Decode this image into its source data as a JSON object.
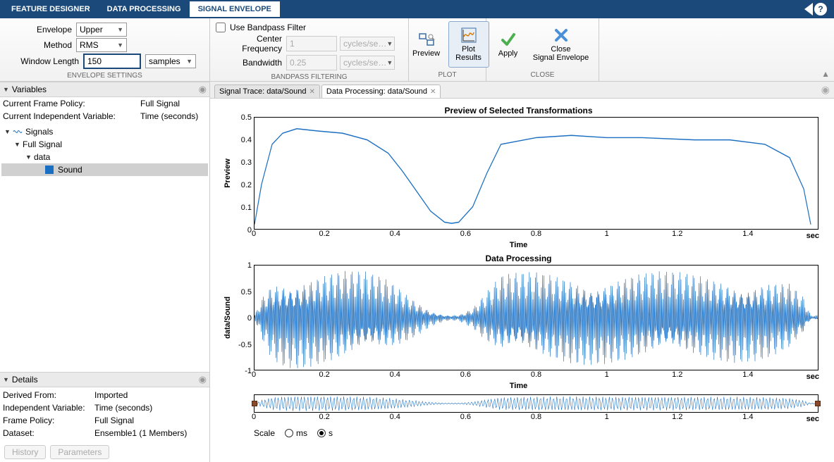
{
  "tabs": {
    "feature": "FEATURE DESIGNER",
    "dp": "DATA PROCESSING",
    "se": "SIGNAL ENVELOPE"
  },
  "settings": {
    "envelope_label": "Envelope",
    "envelope_value": "Upper",
    "method_label": "Method",
    "method_value": "RMS",
    "winlen_label": "Window Length",
    "winlen_value": "150",
    "winlen_unit": "samples",
    "group_label": "ENVELOPE SETTINGS"
  },
  "bandpass": {
    "use_label": "Use Bandpass Filter",
    "use_checked": false,
    "cf_label": "Center Frequency",
    "cf_value": "1",
    "cf_unit": "cycles/se…",
    "bw_label": "Bandwidth",
    "bw_value": "0.25",
    "bw_unit": "cycles/se…",
    "group_label": "BANDPASS FILTERING"
  },
  "plotgrp": {
    "preview": "Preview",
    "plotresults": "Plot\nResults",
    "group_label": "PLOT"
  },
  "closegrp": {
    "apply": "Apply",
    "close": "Close\nSignal Envelope",
    "group_label": "CLOSE"
  },
  "variables": {
    "title": "Variables",
    "frame_policy_k": "Current Frame Policy:",
    "frame_policy_v": "Full Signal",
    "indep_k": "Current Independent Variable:",
    "indep_v": "Time (seconds)",
    "tree": {
      "root": "Signals",
      "l1": "Full Signal",
      "l2": "data",
      "leaf": "Sound"
    }
  },
  "details": {
    "title": "Details",
    "rows": [
      {
        "k": "Derived From:",
        "v": "Imported"
      },
      {
        "k": "Independent Variable:",
        "v": "Time (seconds)"
      },
      {
        "k": "Frame Policy:",
        "v": "Full Signal"
      },
      {
        "k": "Dataset:",
        "v": "Ensemble1 (1 Members)"
      }
    ],
    "tab_history": "History",
    "tab_params": "Parameters"
  },
  "rtabs": {
    "t1": "Signal Trace: data/Sound",
    "t2": "Data Processing: data/Sound"
  },
  "charts": {
    "title1": "Preview of Selected Transformations",
    "ylab1": "Preview",
    "title2": "Data Processing",
    "ylab2": "data/Sound",
    "xlab": "Time",
    "sec": "sec",
    "scale": "Scale",
    "ms": "ms",
    "s": "s"
  },
  "chart_data": [
    {
      "type": "line",
      "title": "Preview of Selected Transformations",
      "xlabel": "Time",
      "ylabel": "Preview",
      "xlim": [
        0,
        1.6
      ],
      "ylim": [
        0,
        0.5
      ],
      "xticks": [
        0,
        0.2,
        0.4,
        0.6,
        0.8,
        1,
        1.2,
        1.4
      ],
      "yticks": [
        0,
        0.1,
        0.2,
        0.3,
        0.4,
        0.5
      ],
      "series": [
        {
          "name": "envelope",
          "x": [
            0,
            0.02,
            0.05,
            0.08,
            0.12,
            0.18,
            0.25,
            0.32,
            0.38,
            0.42,
            0.46,
            0.5,
            0.54,
            0.56,
            0.58,
            0.62,
            0.66,
            0.7,
            0.8,
            0.9,
            1.0,
            1.1,
            1.25,
            1.35,
            1.45,
            1.52,
            1.56,
            1.58
          ],
          "y": [
            0.02,
            0.2,
            0.38,
            0.43,
            0.45,
            0.44,
            0.43,
            0.4,
            0.34,
            0.26,
            0.17,
            0.08,
            0.03,
            0.025,
            0.03,
            0.1,
            0.25,
            0.38,
            0.41,
            0.42,
            0.41,
            0.41,
            0.4,
            0.4,
            0.38,
            0.32,
            0.18,
            0.02
          ]
        }
      ]
    },
    {
      "type": "line",
      "title": "Data Processing",
      "xlabel": "Time",
      "ylabel": "data/Sound",
      "xlim": [
        0,
        1.6
      ],
      "ylim": [
        -1,
        1
      ],
      "xticks": [
        0,
        0.2,
        0.4,
        0.6,
        0.8,
        1,
        1.2,
        1.4
      ],
      "yticks": [
        -1,
        -0.5,
        0,
        0.5,
        1
      ],
      "series": [
        {
          "name": "sound",
          "note": "oscillatory waveform with amplitude envelope approx 2× the Preview curve, peak ≈1 near t≈0.12 and t≈0.7–1.5, min amplitude ≈0.05 near t≈0.55"
        }
      ]
    },
    {
      "type": "line",
      "title": "Panner",
      "xlabel": "Time",
      "ylabel": "",
      "xlim": [
        0,
        1.6
      ],
      "ylim": [
        -1,
        1
      ],
      "xticks": [
        0,
        0.2,
        0.4,
        0.6,
        0.8,
        1,
        1.2,
        1.4
      ],
      "series": [
        {
          "name": "overview",
          "note": "compressed overview of data/Sound"
        }
      ]
    }
  ]
}
